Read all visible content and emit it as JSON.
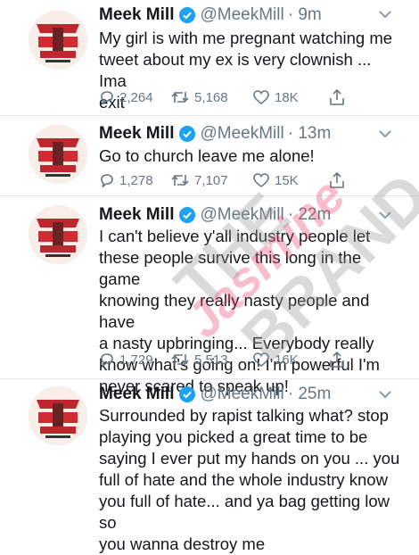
{
  "tweets": [
    {
      "name": "Meek Mill",
      "handle": "@MeekMill",
      "time": "· 9m",
      "lines": [
        "My girl is with me pregnant watching me",
        "tweet about my ex is very clownish ... Ima",
        "exit"
      ],
      "replies": "2,264",
      "retweets": "5,168",
      "likes": "18K"
    },
    {
      "name": "Meek Mill",
      "handle": "@MeekMill",
      "time": "· 13m",
      "lines": [
        "Go to church leave me alone!"
      ],
      "replies": "1,278",
      "retweets": "7,107",
      "likes": "15K"
    },
    {
      "name": "Meek Mill",
      "handle": "@MeekMill",
      "time": "· 22m",
      "lines": [
        "I can't believe y'all industry people let",
        "these people survive this long in the game",
        "knowing they really nasty people and have",
        "a nasty upbringing... Everybody really",
        "know what's going on! I'm powerful I'm",
        "never scared to speak up!"
      ],
      "replies": "1,729",
      "retweets": "5,513",
      "likes": "16K"
    },
    {
      "name": "Meek Mill",
      "handle": "@MeekMill",
      "time": "· 25m",
      "lines": [
        "Surrounded by rapist talking what? stop",
        "playing you picked a great time to be",
        "saying I ever put my hands on you ... you",
        "full of hate and the whole industry know",
        "you full of hate... and ya bag getting low so",
        "you wanna destroy me"
      ],
      "replies": "",
      "retweets": "",
      "likes": ""
    }
  ],
  "watermark": {
    "line1": "THE",
    "line2": "Jasmine",
    "line3": "BRAND"
  },
  "colors": {
    "verified": "#1da1f2",
    "muted": "#657786",
    "text": "#14171a"
  },
  "icons": [
    "reply-icon",
    "retweet-icon",
    "like-icon",
    "share-icon",
    "verified-badge-icon",
    "chevron-down-icon"
  ]
}
